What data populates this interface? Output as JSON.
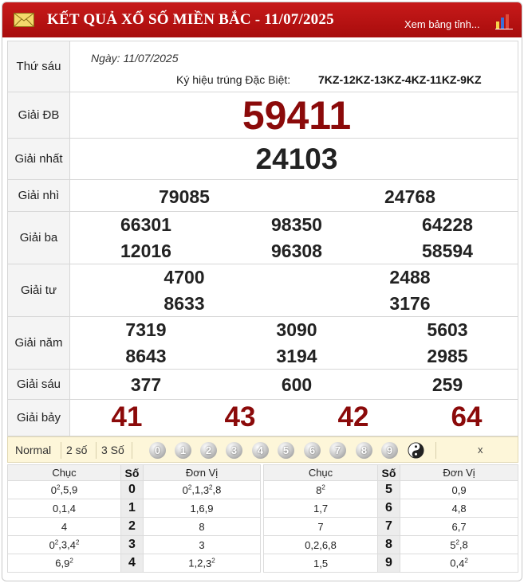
{
  "header": {
    "title": "KẾT QUẢ XỔ SỐ MIỀN BẮC - 11/07/2025",
    "more_link": "Xem bảng tỉnh...",
    "icons": [
      "mail-icon",
      "bar-chart-icon"
    ],
    "colors": {
      "bar": "#b71313",
      "title_text": "#ffffff",
      "special_prize": "#8b0a0a"
    }
  },
  "info": {
    "weekday": "Thứ sáu",
    "date": "Ngày: 11/07/2025",
    "symbol_label": "Ký hiệu trúng Đặc Biệt:",
    "symbol_value": "7KZ-12KZ-13KZ-4KZ-11KZ-9KZ"
  },
  "prizes": {
    "db": {
      "label": "Giải ĐB",
      "numbers": [
        "59411"
      ]
    },
    "g1": {
      "label": "Giải nhất",
      "numbers": [
        "24103"
      ]
    },
    "g2": {
      "label": "Giải nhì",
      "numbers": [
        "79085",
        "24768"
      ]
    },
    "g3": {
      "label": "Giải ba",
      "numbers": [
        "66301",
        "98350",
        "64228",
        "12016",
        "96308",
        "58594"
      ]
    },
    "g4": {
      "label": "Giải tư",
      "numbers": [
        "4700",
        "2488",
        "8633",
        "3176"
      ]
    },
    "g5": {
      "label": "Giải năm",
      "numbers": [
        "7319",
        "3090",
        "5603",
        "8643",
        "3194",
        "2985"
      ]
    },
    "g6": {
      "label": "Giải sáu",
      "numbers": [
        "377",
        "600",
        "259"
      ]
    },
    "g7": {
      "label": "Giải bảy",
      "numbers": [
        "41",
        "43",
        "42",
        "64"
      ]
    }
  },
  "filter": {
    "modes": [
      "Normal",
      "2 số",
      "3 Số"
    ],
    "digits": [
      "0",
      "1",
      "2",
      "3",
      "4",
      "5",
      "6",
      "7",
      "8",
      "9"
    ],
    "yin_yang": "yin-yang-icon",
    "close": "x"
  },
  "loto": {
    "headers": {
      "chuc": "Chục",
      "so": "Số",
      "donvi": "Đơn Vị"
    },
    "left": [
      {
        "chuc": [
          "0²",
          "5",
          "9"
        ],
        "so": "0",
        "donvi": [
          "0²",
          "1",
          "3²",
          "8"
        ]
      },
      {
        "chuc": [
          "0",
          "1",
          "4"
        ],
        "so": "1",
        "donvi": [
          "1",
          "6",
          "9"
        ]
      },
      {
        "chuc": [
          "4"
        ],
        "so": "2",
        "donvi": [
          "8"
        ]
      },
      {
        "chuc": [
          "0²",
          "3",
          "4²"
        ],
        "so": "3",
        "donvi": [
          "3"
        ]
      },
      {
        "chuc": [
          "6",
          "9²"
        ],
        "so": "4",
        "donvi": [
          "1",
          "2",
          "3²"
        ]
      }
    ],
    "right": [
      {
        "chuc": [
          "8²"
        ],
        "so": "5",
        "donvi": [
          "0",
          "9"
        ]
      },
      {
        "chuc": [
          "1",
          "7"
        ],
        "so": "6",
        "donvi": [
          "4",
          "8"
        ]
      },
      {
        "chuc": [
          "7"
        ],
        "so": "7",
        "donvi": [
          "6",
          "7"
        ]
      },
      {
        "chuc": [
          "0",
          "2",
          "6",
          "8"
        ],
        "so": "8",
        "donvi": [
          "5²",
          "8"
        ]
      },
      {
        "chuc": [
          "1",
          "5"
        ],
        "so": "9",
        "donvi": [
          "0",
          "4²"
        ]
      }
    ]
  }
}
